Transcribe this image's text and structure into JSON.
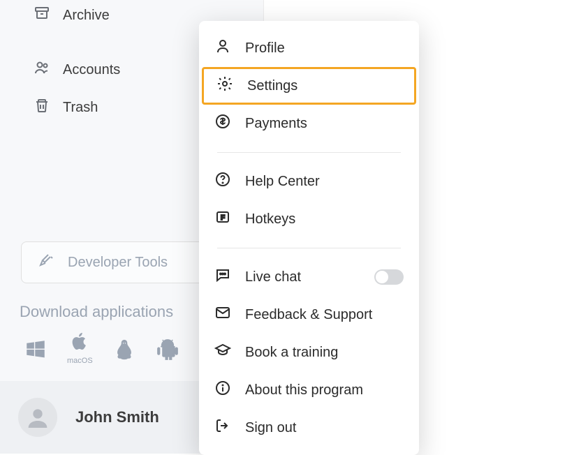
{
  "sidebar": {
    "archive_label": "Archive",
    "accounts_label": "Accounts",
    "trash_label": "Trash"
  },
  "devtools": {
    "label": "Developer Tools"
  },
  "download": {
    "heading": "Download applications",
    "platforms": {
      "macos_label": "macOS"
    }
  },
  "user": {
    "name": "John Smith"
  },
  "menu": {
    "profile": "Profile",
    "settings": "Settings",
    "payments": "Payments",
    "help_center": "Help Center",
    "hotkeys": "Hotkeys",
    "live_chat": "Live chat",
    "feedback_support": "Feedback & Support",
    "book_training": "Book a training",
    "about": "About this program",
    "sign_out": "Sign out"
  }
}
